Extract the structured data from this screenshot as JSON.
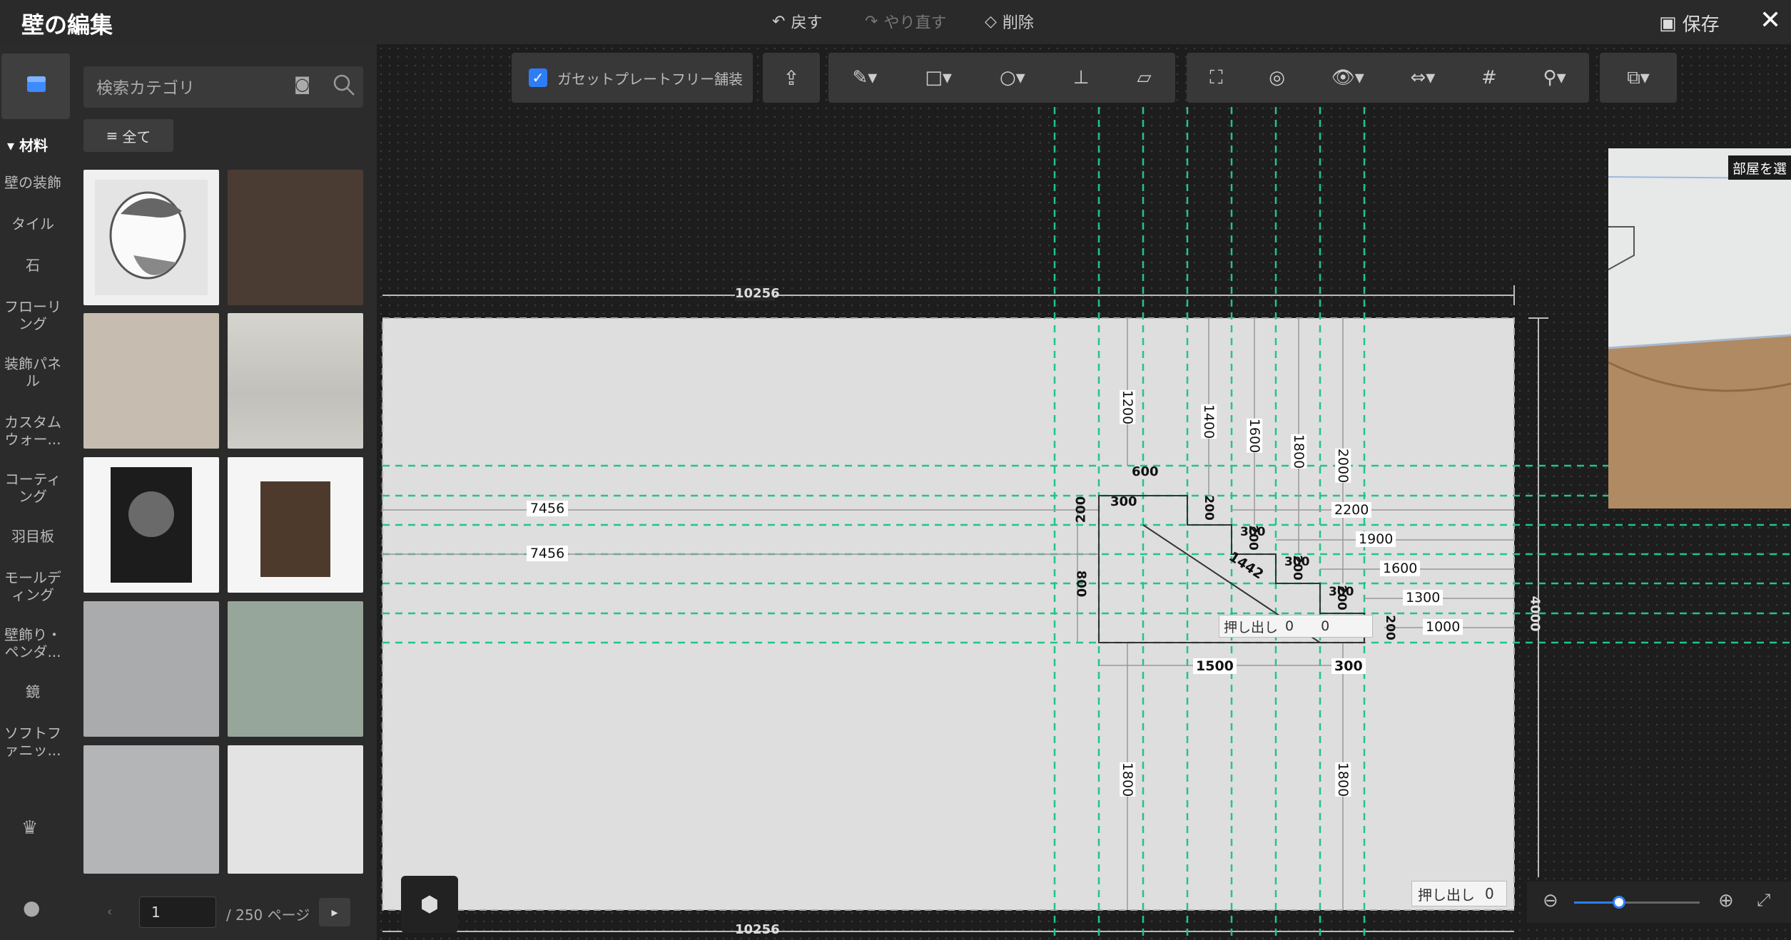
{
  "app": {
    "title": "壁の編集"
  },
  "header": {
    "undo": "戻す",
    "redo": "やり直す",
    "delete": "削除",
    "save": "保存"
  },
  "sidebar": {
    "header": "材料",
    "categories": [
      "壁の装飾",
      "タイル",
      "石",
      "フローリング",
      "装飾パネル",
      "カスタムウォー...",
      "コーティング",
      "羽目板",
      "モールディング",
      "壁飾り・ペンダ...",
      "鏡",
      "ソフトファニッ..."
    ]
  },
  "library": {
    "search_placeholder": "検索カテゴリ",
    "all_button": "全て",
    "page_value": "1",
    "page_total": "/ 250 ページ"
  },
  "toolbar": {
    "gusset_label": "ガセットプレートフリー舗装",
    "gusset_checked": true
  },
  "preview": {
    "label": "部屋を選"
  },
  "canvas": {
    "wall_width": "10256",
    "wall_height": "4000",
    "extrude_label": "押し出し",
    "extrude_value": "0",
    "extrude_mid_values": [
      "0",
      "0"
    ],
    "dimensions": {
      "left_offsets": [
        "7456",
        "7456"
      ],
      "top_heights": [
        "1200",
        "1400",
        "1600",
        "1800",
        "2000"
      ],
      "bottom_heights": [
        "1800",
        "1800"
      ],
      "right_offsets": [
        "2200",
        "1900",
        "1600",
        "1300",
        "1000"
      ],
      "shape_dims": [
        "600",
        "300",
        "200",
        "800",
        "1500",
        "300",
        "200",
        "200",
        "200",
        "200",
        "200",
        "300",
        "300",
        "300",
        "1442"
      ]
    }
  },
  "colors": {
    "accent": "#2f7df6",
    "guide": "#23c487",
    "wall": "#dcdcdc"
  }
}
